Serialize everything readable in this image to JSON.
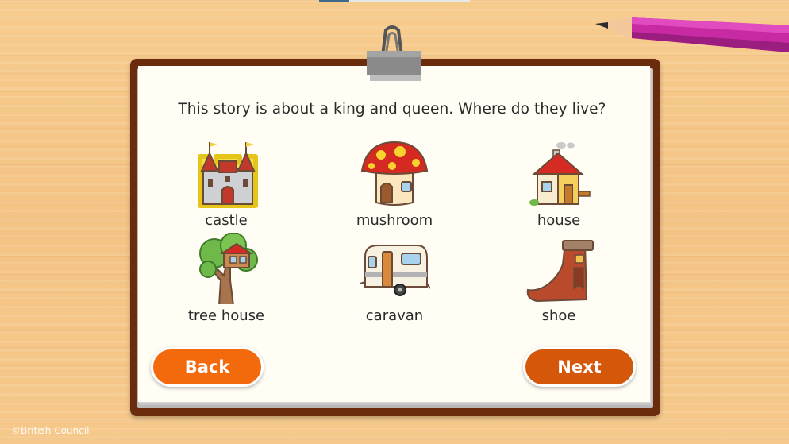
{
  "question": "This story is about a king and queen. Where do they live?",
  "choices": [
    {
      "label": "castle",
      "icon": "castle-icon"
    },
    {
      "label": "mushroom",
      "icon": "mushroom-icon"
    },
    {
      "label": "house",
      "icon": "house-icon"
    },
    {
      "label": "tree house",
      "icon": "tree-house-icon"
    },
    {
      "label": "caravan",
      "icon": "caravan-icon"
    },
    {
      "label": "shoe",
      "icon": "shoe-icon"
    }
  ],
  "buttons": {
    "back_label": "Back",
    "next_label": "Next"
  },
  "footer": {
    "copyright": "©British Council"
  },
  "colors": {
    "button_back": "#f26a0c",
    "button_next": "#d5570a",
    "board": "#6a2c0d",
    "paper": "#fffdf4"
  }
}
